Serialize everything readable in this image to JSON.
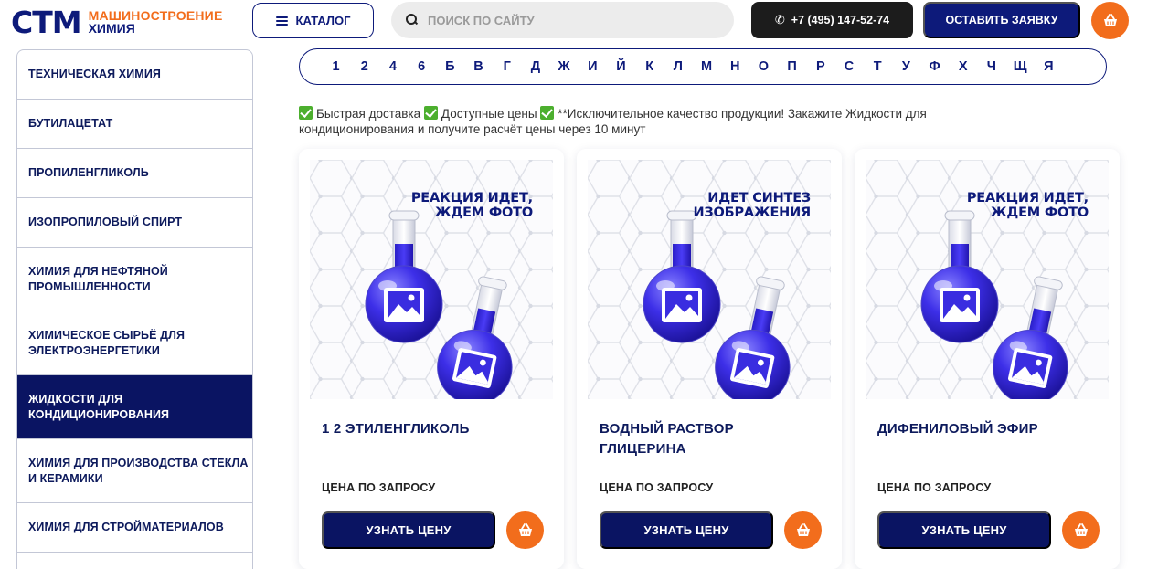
{
  "header": {
    "logo_mark": "СТМ",
    "logo_line1": "МАШИНОСТРОЕНИЕ",
    "logo_line2": "ХИМИЯ",
    "catalog_label": "КАТАЛОГ",
    "search_placeholder": "ПОИСК ПО САЙТУ",
    "phone": "+7 (495) 147-52-74",
    "request_label": "ОСТАВИТЬ ЗАЯВКУ"
  },
  "sidebar": {
    "items": [
      {
        "label": "ТЕХНИЧЕСКАЯ ХИМИЯ"
      },
      {
        "label": "БУТИЛАЦЕТАТ"
      },
      {
        "label": "ПРОПИЛЕНГЛИКОЛЬ"
      },
      {
        "label": "ИЗОПРОПИЛОВЫЙ СПИРТ"
      },
      {
        "label": "ХИМИЯ ДЛЯ НЕФТЯНОЙ ПРОМЫШЛЕННОСТИ"
      },
      {
        "label": "ХИМИЧЕСКОЕ СЫРЬЁ ДЛЯ ЭЛЕКТРОЭНЕРГЕТИКИ"
      },
      {
        "label": "ЖИДКОСТИ ДЛЯ КОНДИЦИОНИРОВАНИЯ"
      },
      {
        "label": "ХИМИЯ ДЛЯ ПРОИЗВОДСТВА СТЕКЛА И КЕРАМИКИ"
      },
      {
        "label": "ХИМИЯ ДЛЯ СТРОЙМАТЕРИАЛОВ"
      }
    ],
    "active_index": 6
  },
  "alphabet": [
    "1",
    "2",
    "4",
    "6",
    "Б",
    "В",
    "Г",
    "Д",
    "Ж",
    "И",
    "Й",
    "К",
    "Л",
    "М",
    "Н",
    "О",
    "П",
    "Р",
    "С",
    "Т",
    "У",
    "Ф",
    "Х",
    "Ч",
    "Щ",
    "Я"
  ],
  "promo": {
    "part1": "Быстрая доставка",
    "part2": "Доступные цены",
    "part3": "**Исключительное качество продукции! Закажите Жидкости для кондиционирования и получите расчёт цены через 10 минут"
  },
  "products": [
    {
      "badge_line1": "РЕАКЦИЯ ИДЕТ,",
      "badge_line2": "ЖДЕМ ФОТО",
      "title": "1 2 ЭТИЛЕНГЛИКОЛЬ",
      "price": "ЦЕНА ПО ЗАПРОСУ",
      "button": "УЗНАТЬ ЦЕНУ"
    },
    {
      "badge_line1": "ИДЕТ СИНТЕЗ",
      "badge_line2": "ИЗОБРАЖЕНИЯ",
      "title": "ВОДНЫЙ РАСТВОР ГЛИЦЕРИНА",
      "price": "ЦЕНА ПО ЗАПРОСУ",
      "button": "УЗНАТЬ ЦЕНУ"
    },
    {
      "badge_line1": "РЕАКЦИЯ ИДЕТ,",
      "badge_line2": "ЖДЕМ ФОТО",
      "title": "ДИФЕНИЛОВЫЙ ЭФИР",
      "price": "ЦЕНА ПО ЗАПРОСУ",
      "button": "УЗНАТЬ ЦЕНУ"
    }
  ],
  "icons": {
    "catalog": "menu-icon",
    "search": "search-icon",
    "phone": "phone-icon",
    "cart": "basket-icon",
    "promo_check": "check-icon",
    "placeholder": "flask-image-placeholder-icon"
  },
  "colors": {
    "brand_navy": "#0d1a7a",
    "active_navy": "#0a1462",
    "accent_orange": "#f26d1c",
    "check_green": "#4caf2e",
    "phone_dark": "#1c1c1c"
  }
}
